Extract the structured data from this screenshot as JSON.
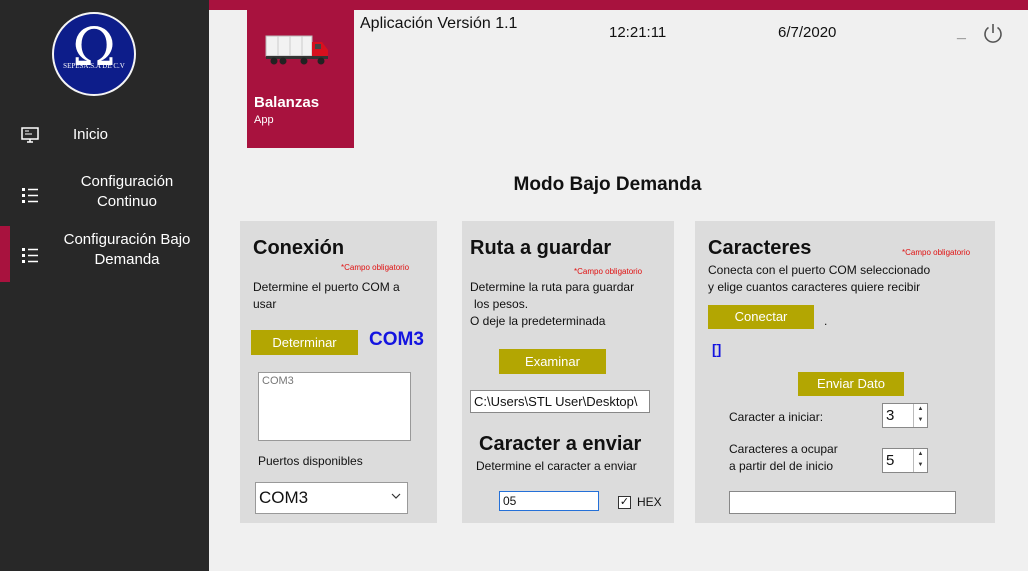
{
  "sidebar": {
    "logo_text": "SEPESA.S.A DE C.V",
    "logo_symbol": "Ω",
    "items": [
      {
        "label": "Inicio",
        "icon": "monitor-icon"
      },
      {
        "label": "Configuración Continuo",
        "icon": "list-icon"
      },
      {
        "label": "Configuración Bajo Demanda",
        "icon": "list-icon",
        "active": true
      }
    ]
  },
  "header": {
    "app_name": "Balanzas",
    "app_sub": "App",
    "version": "Aplicación Versión 1.1",
    "time": "12:21:11",
    "date": "6/7/2020",
    "minimize_label": "_"
  },
  "page_title": "Modo Bajo Demanda",
  "conexion": {
    "heading": "Conexión",
    "required": "*Campo obligatorio",
    "description": "Determine el puerto COM a usar",
    "button": "Determinar",
    "indicator": "COM3",
    "ports_list": [
      "COM3"
    ],
    "ports_label": "Puertos disponibles",
    "selected_port": "COM3"
  },
  "ruta": {
    "heading": "Ruta a guardar",
    "required": "*Campo obligatorio",
    "description_1": "Determine la ruta para guardar",
    "description_2": "los pesos.",
    "description_3": "O deje la predeterminada",
    "button": "Examinar",
    "path": "C:\\Users\\STL User\\Desktop\\",
    "char_heading": "Caracter a enviar",
    "char_description": "Determine el caracter a enviar",
    "char_value": "05",
    "hex_label": "HEX",
    "hex_checked": true
  },
  "caracteres": {
    "heading": "Caracteres",
    "required": "*Campo obligatorio",
    "description_1": "Conecta con el puerto COM seleccionado",
    "description_2": "y elige cuantos caracteres quiere recibir",
    "connect_button": "Conectar",
    "connect_status": ".",
    "received_value": "[]",
    "send_button": "Enviar Dato",
    "start_label": "Caracter a iniciar:",
    "start_value": "3",
    "count_label_1": "Caracteres a ocupar",
    "count_label_2": "a partir del de inicio",
    "count_value": "5",
    "output_value": ""
  },
  "colors": {
    "accent": "#a8123e",
    "sidebar": "#282828",
    "button": "#b3a602",
    "highlight_text": "#1414e0"
  }
}
